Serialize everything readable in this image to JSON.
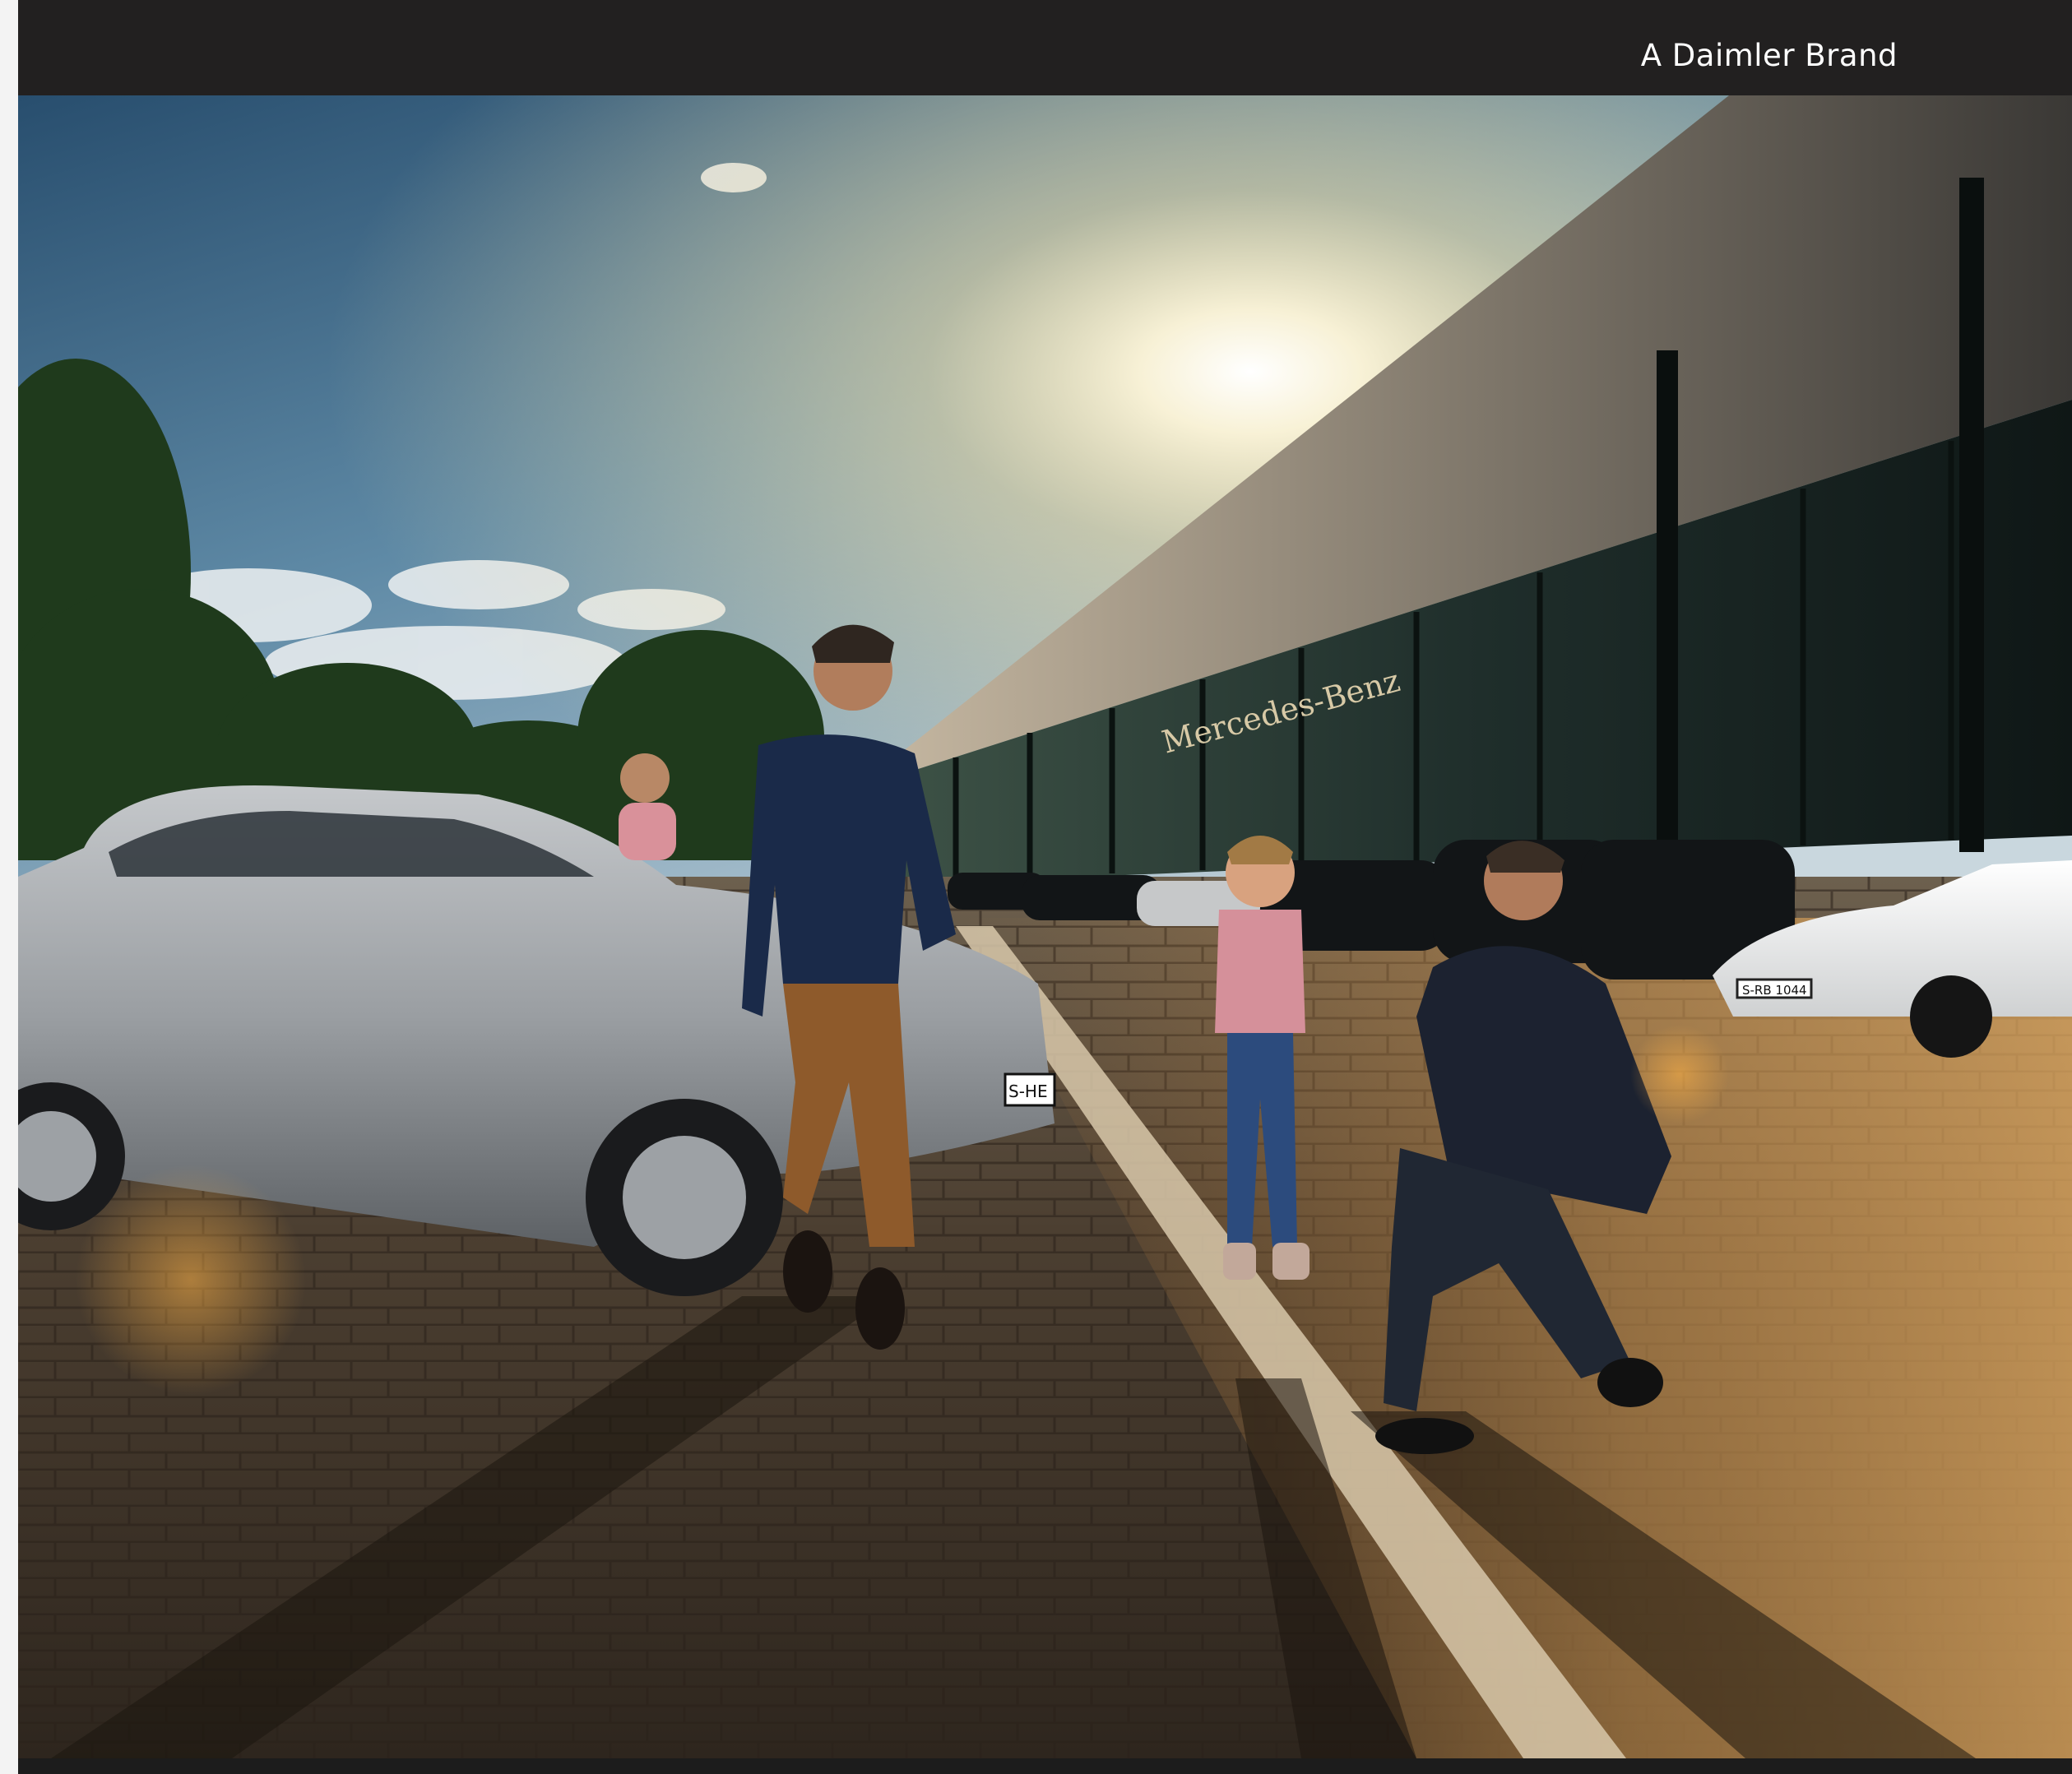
{
  "header": {
    "brand_label": "A Daimler Brand"
  },
  "photo": {
    "storefront_lettering": "Mercedes-Benz",
    "plates": [
      "S-HE",
      "S-RB 1044"
    ]
  },
  "colors": {
    "header_bg": "#222020",
    "page_bg": "#f3f3f3",
    "sky_top": "#2a5577",
    "sun": "#fff4cf",
    "pavement": "#5e4d3a"
  }
}
